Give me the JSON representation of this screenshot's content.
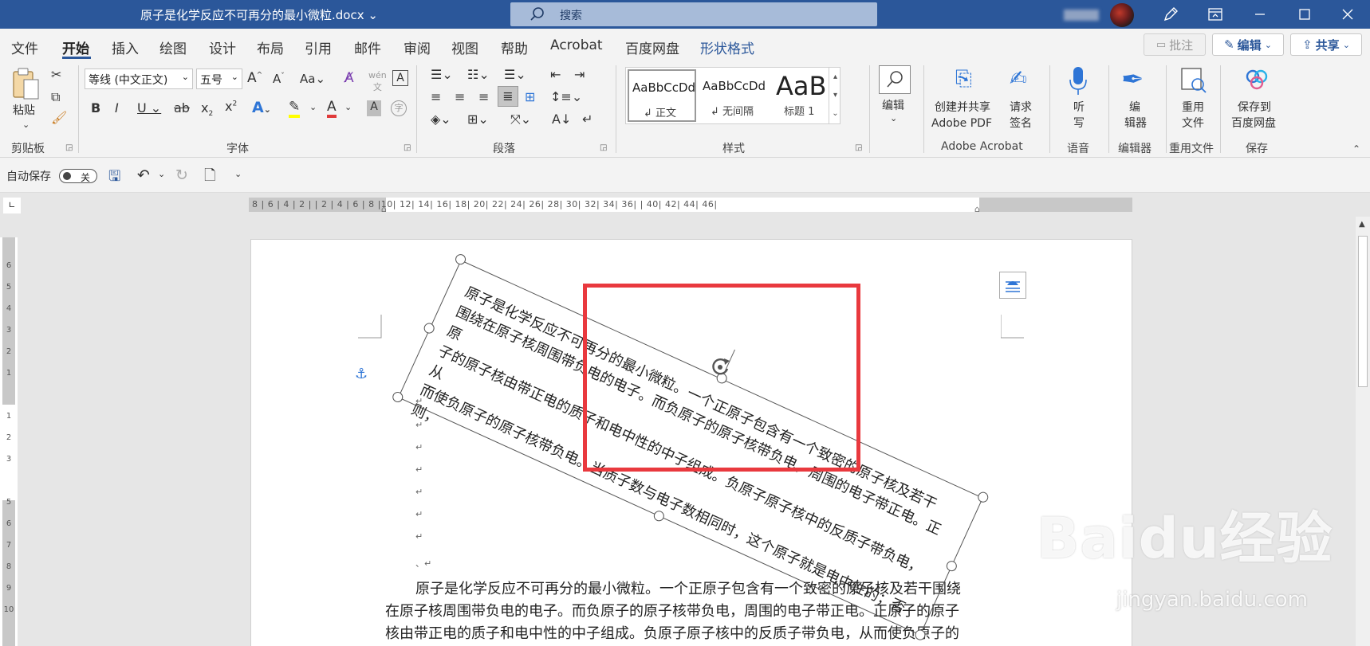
{
  "titlebar": {
    "doc_title": "原子是化学反应不可再分的最小微粒.docx",
    "search_label": "搜索"
  },
  "tabs": [
    "文件",
    "开始",
    "插入",
    "绘图",
    "设计",
    "布局",
    "引用",
    "邮件",
    "审阅",
    "视图",
    "帮助",
    "Acrobat",
    "百度网盘",
    "形状格式"
  ],
  "top_buttons": {
    "comment": "批注",
    "edit": "编辑",
    "share": "共享"
  },
  "ribbon": {
    "clipboard": {
      "paste": "粘贴",
      "group": "剪贴板"
    },
    "font": {
      "font_name": "等线 (中文正文)",
      "font_size": "五号",
      "group": "字体"
    },
    "paragraph": {
      "group": "段落"
    },
    "styles": {
      "group": "样式",
      "items": [
        {
          "preview": "AaBbCcDd",
          "name": "正文"
        },
        {
          "preview": "AaBbCcDd",
          "name": "无间隔"
        },
        {
          "preview": "AaBl",
          "name": "标题 1"
        }
      ]
    },
    "editing": {
      "label": "编辑"
    },
    "acrobat": {
      "create_share": "创建并共享",
      "adobe_pdf": "Adobe PDF",
      "request": "请求",
      "sign": "签名",
      "group": "Adobe Acrobat"
    },
    "voice": {
      "listen": "听",
      "write": "写",
      "group": "语音"
    },
    "editor": {
      "l1": "编",
      "l2": "辑器",
      "group": "编辑器"
    },
    "reuse": {
      "l1": "重用",
      "l2": "文件",
      "group": "重用文件"
    },
    "save": {
      "l1": "保存到",
      "l2": "百度网盘",
      "group": "保存"
    }
  },
  "qat": {
    "autosave": "自动保存",
    "toggle": "关"
  },
  "ruler": {
    "h_ticks": "8 | 6 | 4 | 2 |   | 2 | 4 | 6 | 8 |10| 12| 14| 16| 18| 20| 22| 24| 26| 28| 30| 32| 34| 36|   | 40| 42| 44| 46|",
    "v_ticks": [
      "6",
      "5",
      "4",
      "3",
      "2",
      "1",
      "",
      "1",
      "2",
      "3",
      "",
      "5",
      "6",
      "7",
      "8",
      "9",
      "10"
    ]
  },
  "document": {
    "rotated_text": "原子是化学反应不可再分的最小微粒。一个正原子包含有一个致密的原子核及若干\n围绕在原子核周围带负电的电子。而负原子的原子核带负电，周围的电子带正电。正原\n子的原子核由带正电的质子和电中性的中子组成。负原子原子核中的反质子带负电，从\n而使负原子的原子核带负电。当质子数与电子数相同时，这个原子就是电中性的；否则，",
    "body_lines": [
      "原子是化学反应不可再分的最小微粒。一个正原子包含有一个致密的原子核及若干围绕",
      "在原子核周围带负电的电子。而负原子的原子核带负电，周围的电子带正电。正原子的原子",
      "核由带正电的质子和电中性的中子组成。负原子原子核中的反质子带负电，从而使负原子的"
    ],
    "paragraph_mark": "↵",
    "comma_mark": "、↵"
  },
  "watermark": {
    "main": "Baidu经验",
    "sub": "jingyan.baidu.com"
  },
  "colors": {
    "accent": "#2b579a",
    "highlight_box": "#e9393e"
  }
}
